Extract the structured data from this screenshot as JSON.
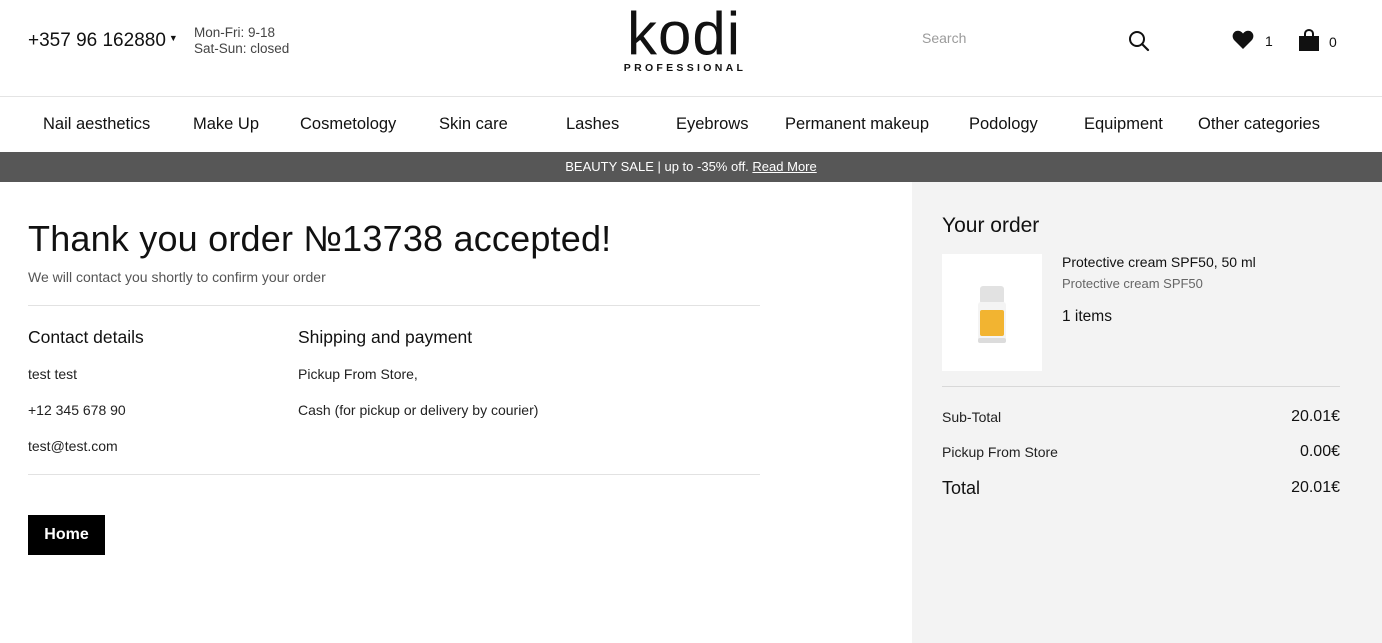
{
  "header": {
    "phone": "+357 96 162880",
    "hours_weekdays": "Mon-Fri: 9-18",
    "hours_weekend": "Sat-Sun: closed",
    "logo_text": "kodi",
    "logo_sub": "PROFESSIONAL",
    "search_placeholder": "Search",
    "wishlist_count": "1",
    "cart_count": "0"
  },
  "nav": {
    "items": [
      "Nail aesthetics",
      "Make Up",
      "Cosmetology",
      "Skin care",
      "Lashes",
      "Eyebrows",
      "Permanent makeup",
      "Podology",
      "Equipment",
      "Other categories"
    ]
  },
  "banner": {
    "text": "BEAUTY SALE | up to -35% off. ",
    "link": "Read More"
  },
  "main": {
    "title": "Thank you order №13738 accepted!",
    "subtitle": "We will contact you shortly to confirm your order",
    "contact": {
      "heading": "Contact details",
      "name": "test test",
      "phone": "+12 345 678 90",
      "email": "test@test.com"
    },
    "shipping": {
      "heading": "Shipping and payment",
      "method": "Pickup From Store,",
      "payment": "Cash (for pickup or delivery by courier)"
    },
    "home_button": "Home"
  },
  "order": {
    "title": "Your order",
    "product": {
      "name": "Protective cream SPF50, 50 ml",
      "subtitle": "Protective cream SPF50",
      "quantity": "1 items"
    },
    "subtotal_label": "Sub-Total",
    "subtotal_value": "20.01€",
    "shipping_label": "Pickup From Store",
    "shipping_value": "0.00€",
    "total_label": "Total",
    "total_value": "20.01€"
  },
  "colors": {
    "banner_bg": "#575757",
    "panel_bg": "#f3f3f3",
    "button_bg": "#000000",
    "product_accent": "#f2b431"
  },
  "icons": [
    "caret-down-icon",
    "search-icon",
    "heart-icon",
    "shopping-bag-icon"
  ]
}
